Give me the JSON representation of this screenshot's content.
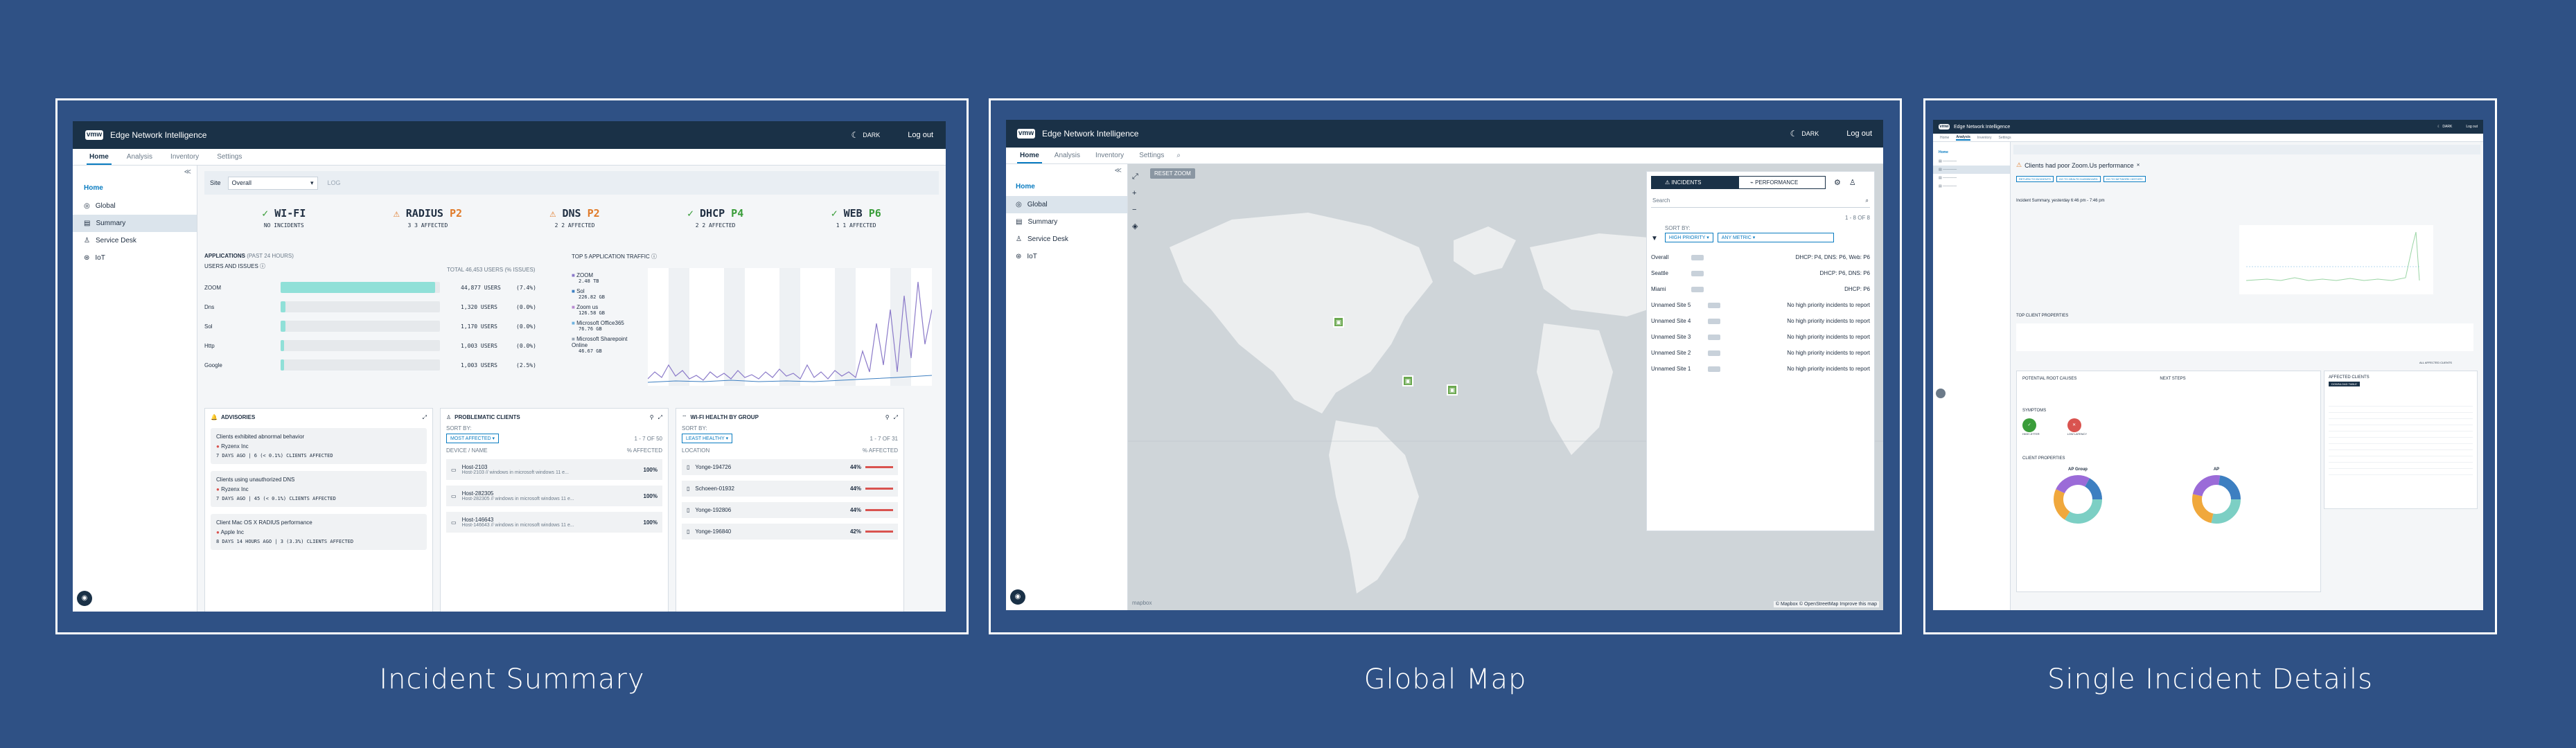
{
  "panels": [
    {
      "caption": "Incident Summary"
    },
    {
      "caption": "Global Map"
    },
    {
      "caption": "Single Incident Details"
    }
  ],
  "app": {
    "logo": "vmw",
    "title": "Edge Network Intelligence",
    "dark": "DARK",
    "logout": "Log out"
  },
  "tabs": [
    "Home",
    "Analysis",
    "Inventory",
    "Settings"
  ],
  "sidebar": {
    "home": "Home",
    "items": [
      "Global",
      "Summary",
      "Service Desk",
      "IoT"
    ]
  },
  "summary": {
    "site_label": "Site",
    "site_value": "Overall",
    "site_extra": "LOG",
    "categories": [
      {
        "icon": "check",
        "name": "WI-FI",
        "priority": "",
        "sub": "NO INCIDENTS",
        "color": "#3a9d3a"
      },
      {
        "icon": "warn",
        "name": "RADIUS",
        "priority": "P2",
        "sub": "3 3 AFFECTED",
        "color": "#e07b2a"
      },
      {
        "icon": "warn",
        "name": "DNS",
        "priority": "P2",
        "sub": "2 2 AFFECTED",
        "color": "#e07b2a"
      },
      {
        "icon": "check",
        "name": "DHCP",
        "priority": "P4",
        "sub": "2 2 AFFECTED",
        "color": "#3a9d3a"
      },
      {
        "icon": "check",
        "name": "WEB",
        "priority": "P6",
        "sub": "1 1 AFFECTED",
        "color": "#3a9d3a"
      }
    ],
    "apps_title": "APPLICATIONS",
    "apps_period": "(PAST 24 HOURS)",
    "apps_sub": "USERS AND ISSUES",
    "total": "TOTAL 46,453 USERS (% ISSUES)",
    "apps": [
      {
        "name": "ZOOM",
        "users": "44,877 USERS",
        "pct": "(7.4%)",
        "fill": 0.97
      },
      {
        "name": "Dns",
        "users": "1,320 USERS",
        "pct": "(0.0%)",
        "fill": 0.03
      },
      {
        "name": "Sol",
        "users": "1,170 USERS",
        "pct": "(0.0%)",
        "fill": 0.03
      },
      {
        "name": "Http",
        "users": "1,003 USERS",
        "pct": "(0.0%)",
        "fill": 0.02
      },
      {
        "name": "Google",
        "users": "1,003 USERS",
        "pct": "(2.5%)",
        "fill": 0.02
      }
    ],
    "traffic_title": "TOP 5 APPLICATION TRAFFIC",
    "traffic_legend": [
      {
        "name": "ZOOM",
        "val": "2.48 TB",
        "color": "#8b7ac9"
      },
      {
        "name": "Sol",
        "val": "226.82 GB",
        "color": "#3d7fc1"
      },
      {
        "name": "Zoom us",
        "val": "126.58 GB",
        "color": "#b88ad0"
      },
      {
        "name": "Microsoft Office365",
        "val": "76.76 GB",
        "color": "#6fb3e0"
      },
      {
        "name": "Microsoft Sharepoint Online",
        "val": "46.67 GB",
        "color": "#9aa6b4"
      }
    ],
    "advisories": {
      "title": "ADVISORIES",
      "items": [
        {
          "title": "Clients exhibited abnormal behavior",
          "org": "Ryzenx Inc",
          "meta": "7 DAYS AGO  |  6 (< 0.1%) CLIENTS AFFECTED"
        },
        {
          "title": "Clients using unauthorized DNS",
          "org": "Ryzenx Inc",
          "meta": "7 DAYS AGO  |  45 (< 0.1%) CLIENTS AFFECTED"
        },
        {
          "title": "Client Mac OS X RADIUS performance",
          "org": "Apple Inc",
          "meta": "8 DAYS 14 HOURS AGO  |  3 (3.3%) CLIENTS AFFECTED"
        }
      ]
    },
    "problematic": {
      "title": "PROBLEMATIC CLIENTS",
      "sort": "SORT BY:",
      "sort_val": "MOST AFFECTED",
      "pager": "1 - 7 OF 50",
      "col1": "DEVICE / NAME",
      "col2": "% AFFECTED",
      "rows": [
        {
          "host": "Host-2103",
          "sub": "Host-2103 // windows in microsoft windows 11 e...",
          "pct": "100%"
        },
        {
          "host": "Host-282305",
          "sub": "Host-282305 // windows in microsoft windows 11 e...",
          "pct": "100%"
        },
        {
          "host": "Host-146643",
          "sub": "Host-146643 // windows in microsoft windows 11 e...",
          "pct": "100%"
        }
      ]
    },
    "wifi": {
      "title": "WI-FI HEALTH BY GROUP",
      "sort": "SORT BY:",
      "sort_val": "LEAST HEALTHY",
      "pager": "1 - 7 OF 31",
      "col1": "LOCATION",
      "col2": "% AFFECTED",
      "rows": [
        {
          "name": "Yonge-194726",
          "pct": "44%"
        },
        {
          "name": "Schoeen-01932",
          "pct": "44%"
        },
        {
          "name": "Yonge-192806",
          "pct": "44%"
        },
        {
          "name": "Yonge-196840",
          "pct": "42%"
        }
      ]
    }
  },
  "map": {
    "reset": "RESET ZOOM",
    "tab_incidents": "INCIDENTS",
    "tab_performance": "PERFORMANCE",
    "search": "Search",
    "pager": "1 - 8 OF 8",
    "sort": "SORT BY:",
    "sort_val": "HIGH PRIORITY",
    "metric_val": "ANY METRIC",
    "rows": [
      {
        "name": "Overall",
        "text": "DHCP: P4, DNS: P6, Web: P6"
      },
      {
        "name": "Seattle",
        "text": "DHCP: P6, DNS: P6"
      },
      {
        "name": "Miami",
        "text": "DHCP: P6"
      },
      {
        "name": "Unnamed Site 5",
        "text": "No high priority incidents to report"
      },
      {
        "name": "Unnamed Site 4",
        "text": "No high priority incidents to report"
      },
      {
        "name": "Unnamed Site 3",
        "text": "No high priority incidents to report"
      },
      {
        "name": "Unnamed Site 2",
        "text": "No high priority incidents to report"
      },
      {
        "name": "Unnamed Site 1",
        "text": "No high priority incidents to report"
      }
    ],
    "attribution": "© Mapbox © OpenStreetMap Improve this map",
    "mapbox": "mapbox"
  },
  "detail": {
    "title": "Clients had poor Zoom.Us performance",
    "buttons": [
      "RETURN TO INCIDENTS",
      "GO TO HEALTH DASHBOARD",
      "GO TO NETWORK HISTORY"
    ],
    "summary": "Incident Summary, yesterday 6:46 pm - 7:46 pm",
    "top_title": "TOP CLIENT PROPERTIES",
    "potential": "POTENTIAL ROOT CAUSES",
    "next": "NEXT STEPS",
    "symptoms": "SYMPTOMS",
    "sym1": "HIGH JITTER",
    "sym2": "LOW LATENCY",
    "client_props": "CLIENT PROPERTIES",
    "donut1": "AP Group",
    "donut2": "AP",
    "affected": "AFFECTED CLIENTS",
    "download": "DOWNLOAD TABLE",
    "all_affected": "ALL AFFECTED CLIENTS"
  }
}
